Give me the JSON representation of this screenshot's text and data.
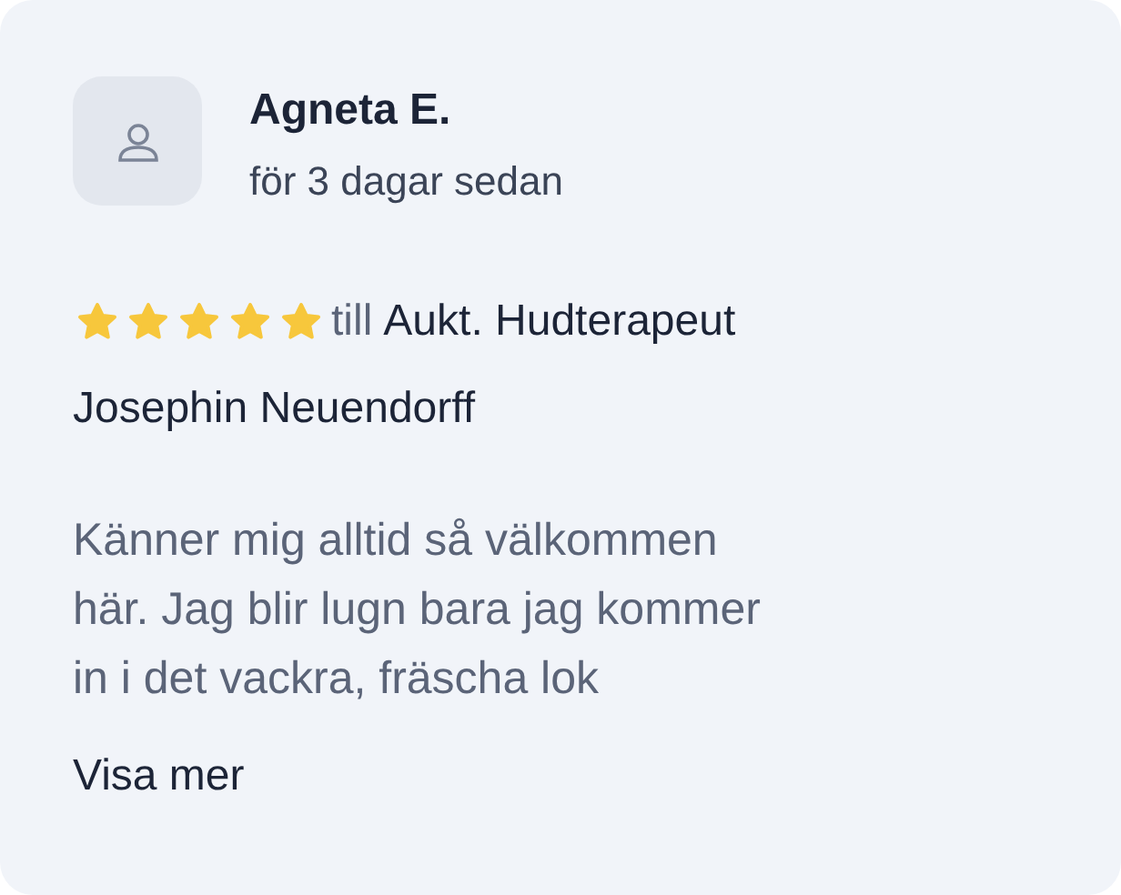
{
  "review": {
    "author": "Agneta E.",
    "time": "för 3 dagar sedan",
    "stars": 5,
    "connector": "till",
    "title": "Aukt. Hudterapeut",
    "therapist": "Josephin Neuendorff",
    "text_lines": [
      "Känner mig alltid så välkommen",
      "här. Jag blir lugn bara jag kommer",
      "in i det vackra, fräscha lok"
    ],
    "more": "Visa mer"
  }
}
